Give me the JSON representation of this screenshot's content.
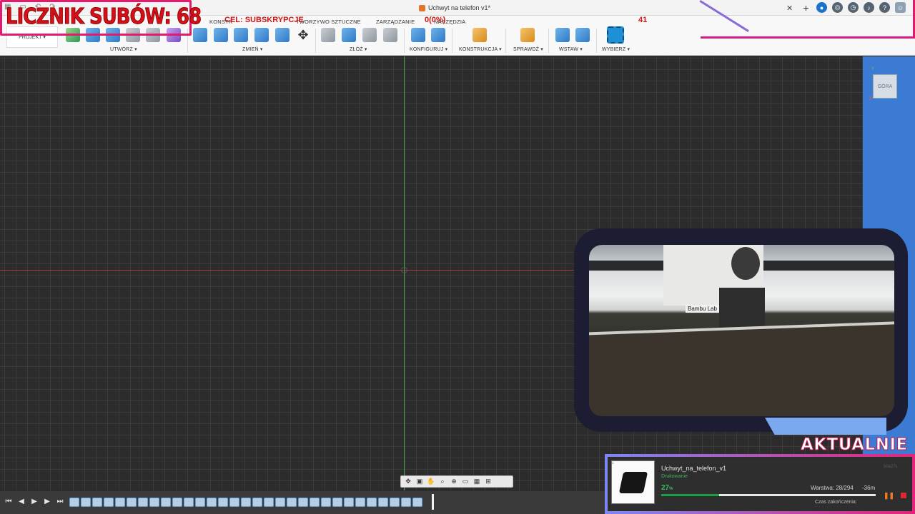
{
  "app": {
    "document_title": "Uchwyt na telefon v1*",
    "tabs": [
      "KONSTR",
      "TWORZYWO SZTUCZNE",
      "ZARZĄDZANIE",
      "NARZĘDZIA"
    ],
    "project_label": "PROJEKT",
    "group_labels": [
      "UTWÓRZ",
      "ZMIEŃ",
      "ZŁÓŻ",
      "KONFIGURUJ",
      "KONSTRUKCJA",
      "SPRAWDŹ",
      "WSTAW",
      "WYBIERZ"
    ],
    "viewcube_label": "GÓRA"
  },
  "overlay": {
    "sub_counter": "LICZNIK SUBÓW: 68",
    "goal_label": "CEL: SUBSKRYPCJE",
    "goal_value": "0(0%)",
    "goal_number": "41",
    "now_label": "AKTUALNIE"
  },
  "camera": {
    "brand": "Bambu Lab"
  },
  "print_job": {
    "index": "1",
    "name": "Uchwyt_na_telefon_v1",
    "status": "Drukowanie",
    "id_label": "50e27c",
    "percent": "27",
    "percent_unit": "%",
    "progress": 0.27,
    "layer": "Warstwa: 28/294",
    "eta": "-36m",
    "finish_label": "Czas zakończenia:",
    "pause_icon": "pause-icon",
    "stop_icon": "stop-icon"
  },
  "colors": {
    "accent_pink": "#e31b6d",
    "accent_red": "#cf1616",
    "progress_green": "#1d9f47"
  }
}
